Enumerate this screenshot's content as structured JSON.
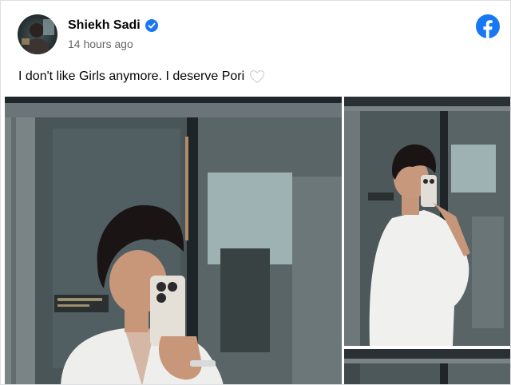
{
  "post": {
    "author": "Shiekh Sadi",
    "timestamp": "14 hours ago",
    "text": "I don't like Girls anymore. I deserve Pori",
    "icons": {
      "verified": "verified-badge-icon",
      "brand": "facebook-logo-icon",
      "emoji": "white-heart-icon"
    }
  },
  "colors": {
    "brand_blue": "#1877f2",
    "text_primary": "#050505",
    "text_secondary": "#65676b"
  }
}
